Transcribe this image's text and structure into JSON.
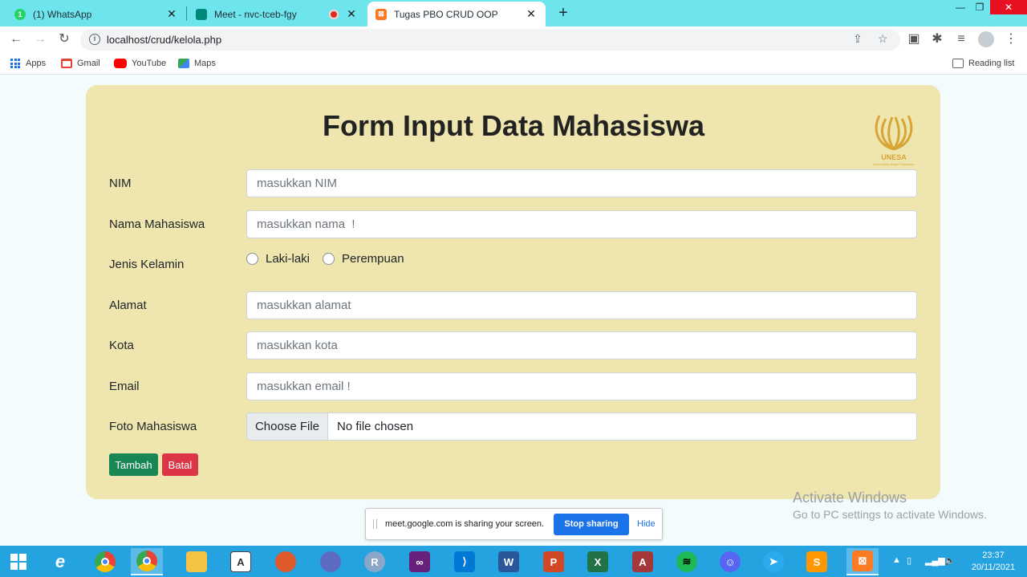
{
  "browser": {
    "tabs": [
      {
        "title": "(1) WhatsApp",
        "favicon": "whatsapp-icon",
        "color": "#25d366"
      },
      {
        "title": "Meet - nvc-tceb-fgy",
        "favicon": "google-meet-icon",
        "color": "#00897b"
      },
      {
        "title": "Tugas PBO CRUD OOP",
        "favicon": "xampp-icon",
        "color": "#fb7a24"
      }
    ],
    "active_tab": 2,
    "url": "localhost/crud/kelola.php",
    "bookmarks": [
      {
        "label": "Apps",
        "icon": "apps-grid-icon"
      },
      {
        "label": "Gmail",
        "icon": "gmail-icon"
      },
      {
        "label": "YouTube",
        "icon": "youtube-icon"
      },
      {
        "label": "Maps",
        "icon": "maps-icon"
      }
    ],
    "reading_list": "Reading list"
  },
  "form": {
    "title": "Form Input Data Mahasiswa",
    "logo": "unesa-logo",
    "fields": {
      "nim": {
        "label": "NIM",
        "placeholder": "masukkan NIM"
      },
      "nama": {
        "label": "Nama Mahasiswa",
        "placeholder": "masukkan nama  !"
      },
      "jenis_kelamin": {
        "label": "Jenis Kelamin",
        "options": [
          "Laki-laki",
          "Perempuan"
        ]
      },
      "alamat": {
        "label": "Alamat",
        "placeholder": "masukkan alamat"
      },
      "kota": {
        "label": "Kota",
        "placeholder": "masukkan kota"
      },
      "email": {
        "label": "Email",
        "placeholder": "masukkan email !"
      },
      "foto": {
        "label": "Foto Mahasiswa",
        "button": "Choose File",
        "status": "No file chosen"
      }
    },
    "buttons": {
      "submit": "Tambah",
      "cancel": "Batal"
    },
    "colors": {
      "card": "#eee6ae",
      "submit": "#198754",
      "cancel": "#dc3545"
    }
  },
  "watermark": {
    "line1": "Activate Windows",
    "line2": "Go to PC settings to activate Windows."
  },
  "share_bar": {
    "message": "meet.google.com is sharing your screen.",
    "stop": "Stop sharing",
    "hide": "Hide"
  },
  "taskbar": {
    "apps": [
      "start-icon",
      "internet-explorer-icon",
      "chrome-icon",
      "chrome-active-icon",
      "file-explorer-icon",
      "paint-icon",
      "app-icon",
      "app-icon-2",
      "r-icon",
      "visual-studio-icon",
      "vscode-icon",
      "word-icon",
      "powerpoint-icon",
      "excel-icon",
      "access-icon",
      "spotify-icon",
      "discord-icon",
      "telegram-icon",
      "sublime-text-icon",
      "xampp-icon"
    ],
    "time": "23:37",
    "date": "20/11/2021"
  }
}
